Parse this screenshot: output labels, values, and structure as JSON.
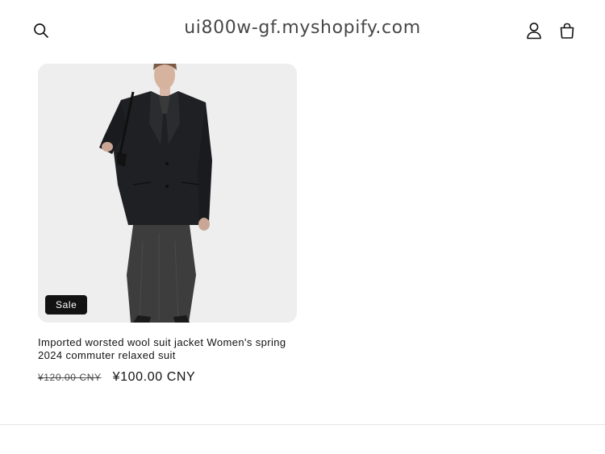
{
  "header": {
    "store_name": "ui800w-gf.myshopify.com",
    "icons": {
      "search": "search-icon",
      "account": "account-icon",
      "cart": "cart-icon"
    }
  },
  "product": {
    "badge": "Sale",
    "title": "Imported worsted wool suit jacket Women's spring 2024 commuter relaxed suit",
    "regular_price": "¥120.00 CNY",
    "sale_price": "¥100.00 CNY"
  },
  "colors": {
    "text": "#121212",
    "badge_background": "#121212",
    "badge_text": "#ffffff",
    "media_background": "#eeeeee",
    "divider": "#e6e6e6"
  }
}
